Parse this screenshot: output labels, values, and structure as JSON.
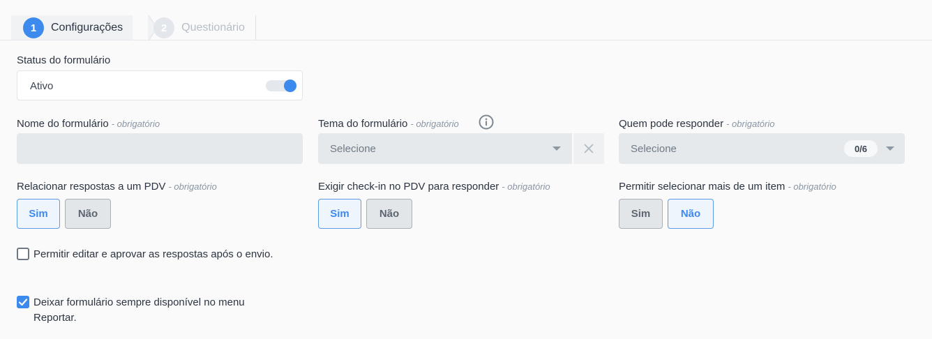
{
  "stepper": {
    "steps": [
      {
        "number": "1",
        "label": "Configurações"
      },
      {
        "number": "2",
        "label": "Questionário"
      }
    ]
  },
  "status": {
    "label": "Status do formulário",
    "value": "Ativo",
    "toggle_on": true
  },
  "required_text": "- obrigatório",
  "name_field": {
    "label": "Nome do formulário",
    "value": ""
  },
  "theme_field": {
    "label": "Tema do formulário",
    "placeholder": "Selecione"
  },
  "respondents_field": {
    "label": "Quem pode responder",
    "placeholder": "Selecione",
    "count": "0/6"
  },
  "relate_responses": {
    "label": "Relacionar respostas a um PDV",
    "yes": "Sim",
    "no": "Não",
    "selected": "Sim"
  },
  "require_checkin": {
    "label": "Exigir check-in no PDV para responder",
    "yes": "Sim",
    "no": "Não",
    "selected": "Sim"
  },
  "allow_multiple": {
    "label": "Permitir selecionar mais de um item",
    "yes": "Sim",
    "no": "Não",
    "selected": "Não"
  },
  "checkboxes": [
    {
      "label": "Permitir editar e aprovar as respostas após o envio.",
      "checked": false
    },
    {
      "label": "Deixar formulário sempre disponível no menu Reportar.",
      "checked": true
    }
  ],
  "colors": {
    "accent": "#3d8aef",
    "field_bg": "#e6e9ec"
  }
}
